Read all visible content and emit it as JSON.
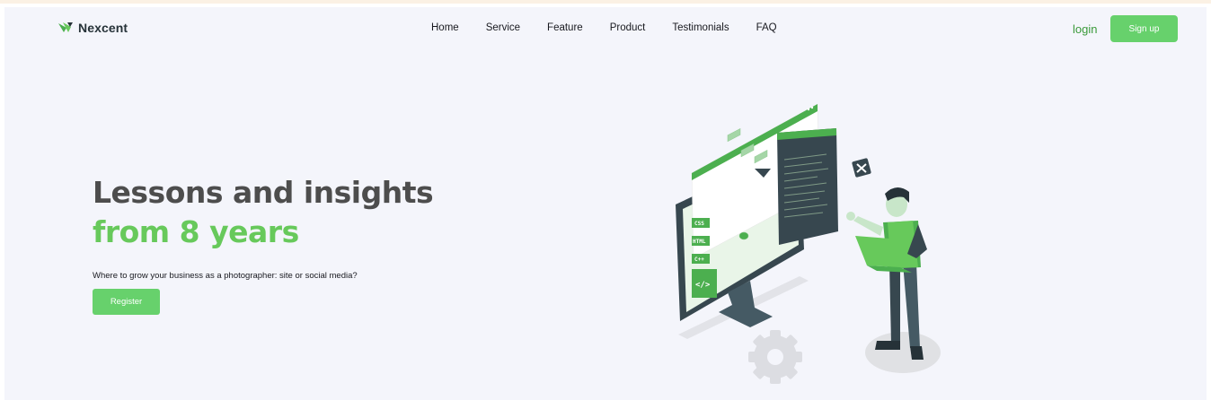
{
  "brand": {
    "name": "Nexcent",
    "icon": "nexcent-logo-icon"
  },
  "nav": [
    {
      "label": "Home"
    },
    {
      "label": "Service"
    },
    {
      "label": "Feature"
    },
    {
      "label": "Product"
    },
    {
      "label": "Testimonials"
    },
    {
      "label": "FAQ"
    }
  ],
  "auth": {
    "login_label": "login",
    "signup_label": "Sign up"
  },
  "hero": {
    "title_line1": "Lessons and insights",
    "title_line2": "from 8 years",
    "subtitle": "Where to grow your business as a photographer: site or social media?",
    "cta_label": "Register"
  },
  "illustration": {
    "tags": [
      "CSS",
      "HTML",
      "C++"
    ],
    "code_icon": "</>"
  },
  "colors": {
    "primary": "#4CAF4F",
    "button": "#67d16c",
    "heading": "#4d4d4d",
    "background": "#f4f5fb",
    "dark": "#37474f"
  }
}
